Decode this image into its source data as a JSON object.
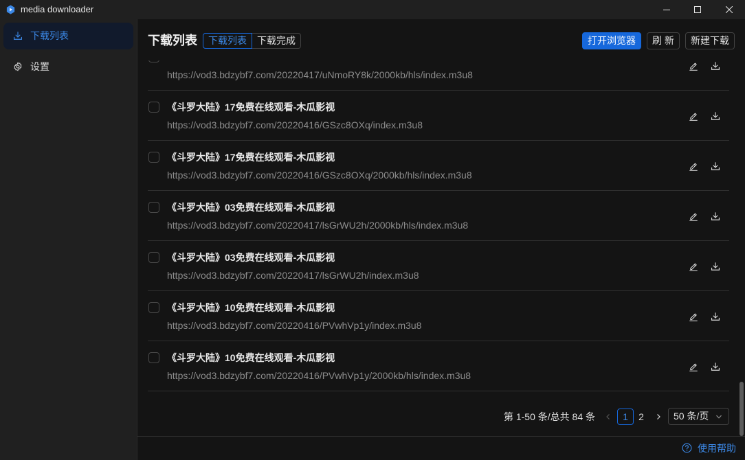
{
  "window": {
    "title": "media downloader",
    "app_icon": "app-logo-icon",
    "controls": [
      "minimize-icon",
      "maximize-icon",
      "close-icon"
    ]
  },
  "sidebar": {
    "items": [
      {
        "label": "下载列表",
        "icon": "download-icon",
        "selected": true
      },
      {
        "label": "设置",
        "icon": "gear-icon",
        "selected": false
      }
    ]
  },
  "header": {
    "title": "下载列表",
    "tabs": [
      {
        "label": "下载列表",
        "active": true
      },
      {
        "label": "下载完成",
        "active": false
      }
    ],
    "buttons": {
      "open_browser": "打开浏览器",
      "refresh": "刷 新",
      "new_download": "新建下载"
    }
  },
  "list": {
    "row_icons": [
      "edit-icon",
      "download-icon"
    ],
    "items": [
      {
        "title": "",
        "url": "https://vod3.bdzybf7.com/20220417/uNmoRY8k/2000kb/hls/index.m3u8",
        "checked": false
      },
      {
        "title": "《斗罗大陆》17免费在线观看-木瓜影视",
        "url": "https://vod3.bdzybf7.com/20220416/GSzc8OXq/index.m3u8",
        "checked": false
      },
      {
        "title": "《斗罗大陆》17免费在线观看-木瓜影视",
        "url": "https://vod3.bdzybf7.com/20220416/GSzc8OXq/2000kb/hls/index.m3u8",
        "checked": false
      },
      {
        "title": "《斗罗大陆》03免费在线观看-木瓜影视",
        "url": "https://vod3.bdzybf7.com/20220417/lsGrWU2h/2000kb/hls/index.m3u8",
        "checked": false
      },
      {
        "title": "《斗罗大陆》03免费在线观看-木瓜影视",
        "url": "https://vod3.bdzybf7.com/20220417/lsGrWU2h/index.m3u8",
        "checked": false
      },
      {
        "title": "《斗罗大陆》10免费在线观看-木瓜影视",
        "url": "https://vod3.bdzybf7.com/20220416/PVwhVp1y/index.m3u8",
        "checked": false
      },
      {
        "title": "《斗罗大陆》10免费在线观看-木瓜影视",
        "url": "https://vod3.bdzybf7.com/20220416/PVwhVp1y/2000kb/hls/index.m3u8",
        "checked": false
      }
    ]
  },
  "pagination": {
    "total_text": "第 1-50 条/总共 84 条",
    "pages": [
      "1",
      "2"
    ],
    "current_page": "1",
    "page_size": "50 条/页"
  },
  "footer": {
    "help_label": "使用帮助",
    "help_icon": "question-circle-icon"
  },
  "colors": {
    "primary": "#1668dc",
    "link": "#3c89e8",
    "sidebar_bg": "#202020",
    "main_bg": "#141414",
    "selected_bg": "#111a2c"
  }
}
